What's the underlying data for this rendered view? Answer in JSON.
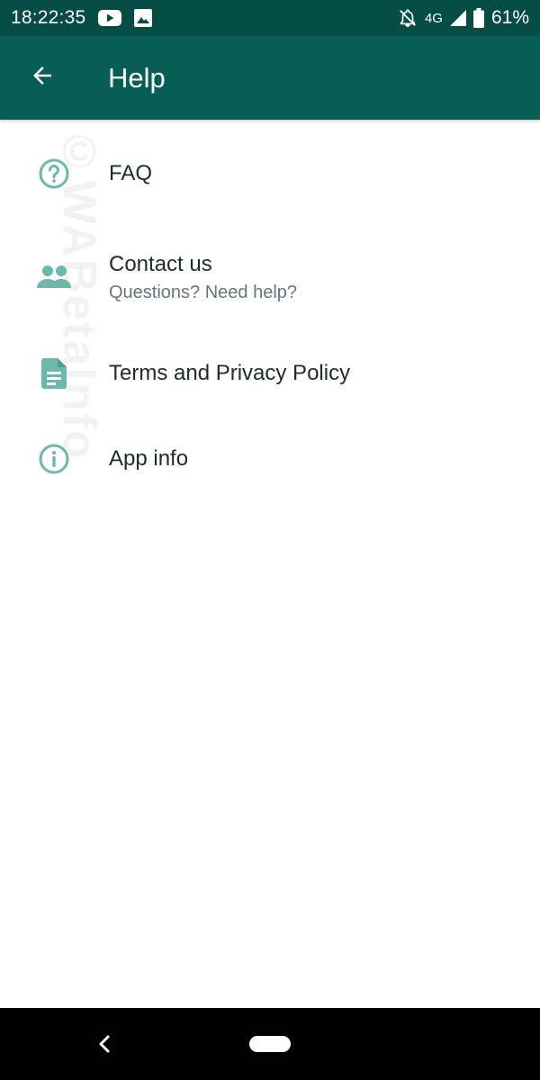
{
  "status_bar": {
    "time": "18:22:35",
    "network": "4G",
    "battery": "61%",
    "icons": [
      "youtube-icon",
      "image-icon",
      "notifications-off-icon",
      "signal-icon",
      "battery-icon"
    ]
  },
  "app_bar": {
    "title": "Help",
    "back_icon": "arrow-back-icon"
  },
  "menu": {
    "items": [
      {
        "icon": "help-circle-icon",
        "label": "FAQ"
      },
      {
        "icon": "contacts-icon",
        "label": "Contact us",
        "sublabel": "Questions? Need help?"
      },
      {
        "icon": "document-icon",
        "label": "Terms and Privacy Policy"
      },
      {
        "icon": "info-icon",
        "label": "App info"
      }
    ]
  },
  "watermark": "©WABetaInfo",
  "nav_bar": {
    "icons": [
      "nav-back-icon",
      "nav-home-pill"
    ]
  },
  "colors": {
    "status_bar": "#054d44",
    "app_bar": "#075e54",
    "icon_teal": "#6cb8ab",
    "primary_text": "#1f2a2c",
    "secondary_text": "#6b7477"
  }
}
